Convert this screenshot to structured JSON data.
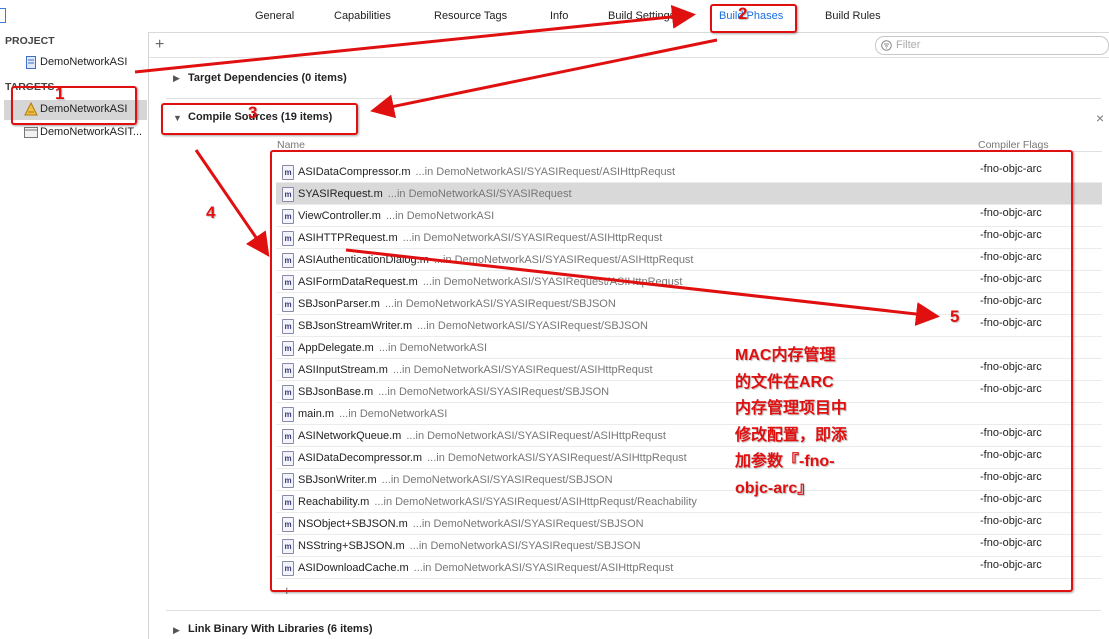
{
  "tabs": [
    "General",
    "Capabilities",
    "Resource Tags",
    "Info",
    "Build Settings",
    "Build Phases",
    "Build Rules"
  ],
  "sidebar": {
    "project_header": "PROJECT",
    "project_item": "DemoNetworkASI",
    "targets_header": "TARGETS",
    "targets": [
      "DemoNetworkASI",
      "DemoNetworkASIT..."
    ]
  },
  "toolbar": {
    "add": "+",
    "filter_placeholder": "Filter"
  },
  "sections": {
    "target_dependencies": "Target Dependencies (0 items)",
    "compile_sources": "Compile Sources (19 items)",
    "link_binary": "Link Binary With Libraries (6 items)",
    "close": "×"
  },
  "table": {
    "col_name": "Name",
    "col_flags": "Compiler Flags",
    "add": "+",
    "rows": [
      {
        "file": "ASIDataCompressor.m",
        "path": "...in DemoNetworkASI/SYASIRequest/ASIHttpRequst",
        "flags": "-fno-objc-arc"
      },
      {
        "file": "SYASIRequest.m",
        "path": "...in DemoNetworkASI/SYASIRequest",
        "flags": ""
      },
      {
        "file": "ViewController.m",
        "path": "...in DemoNetworkASI",
        "flags": "-fno-objc-arc"
      },
      {
        "file": "ASIHTTPRequest.m",
        "path": "...in DemoNetworkASI/SYASIRequest/ASIHttpRequst",
        "flags": "-fno-objc-arc"
      },
      {
        "file": "ASIAuthenticationDialog.m",
        "path": "...in DemoNetworkASI/SYASIRequest/ASIHttpRequst",
        "flags": "-fno-objc-arc"
      },
      {
        "file": "ASIFormDataRequest.m",
        "path": "...in DemoNetworkASI/SYASIRequest/ASIHttpRequst",
        "flags": "-fno-objc-arc"
      },
      {
        "file": "SBJsonParser.m",
        "path": "...in DemoNetworkASI/SYASIRequest/SBJSON",
        "flags": "-fno-objc-arc"
      },
      {
        "file": "SBJsonStreamWriter.m",
        "path": "...in DemoNetworkASI/SYASIRequest/SBJSON",
        "flags": "-fno-objc-arc"
      },
      {
        "file": "AppDelegate.m",
        "path": "...in DemoNetworkASI",
        "flags": ""
      },
      {
        "file": "ASIInputStream.m",
        "path": "...in DemoNetworkASI/SYASIRequest/ASIHttpRequst",
        "flags": "-fno-objc-arc"
      },
      {
        "file": "SBJsonBase.m",
        "path": "...in DemoNetworkASI/SYASIRequest/SBJSON",
        "flags": "-fno-objc-arc"
      },
      {
        "file": "main.m",
        "path": "...in DemoNetworkASI",
        "flags": ""
      },
      {
        "file": "ASINetworkQueue.m",
        "path": "...in DemoNetworkASI/SYASIRequest/ASIHttpRequst",
        "flags": "-fno-objc-arc"
      },
      {
        "file": "ASIDataDecompressor.m",
        "path": "...in DemoNetworkASI/SYASIRequest/ASIHttpRequst",
        "flags": "-fno-objc-arc"
      },
      {
        "file": "SBJsonWriter.m",
        "path": "...in DemoNetworkASI/SYASIRequest/SBJSON",
        "flags": "-fno-objc-arc"
      },
      {
        "file": "Reachability.m",
        "path": "...in DemoNetworkASI/SYASIRequest/ASIHttpRequst/Reachability",
        "flags": "-fno-objc-arc"
      },
      {
        "file": "NSObject+SBJSON.m",
        "path": "...in DemoNetworkASI/SYASIRequest/SBJSON",
        "flags": "-fno-objc-arc"
      },
      {
        "file": "NSString+SBJSON.m",
        "path": "...in DemoNetworkASI/SYASIRequest/SBJSON",
        "flags": "-fno-objc-arc"
      },
      {
        "file": "ASIDownloadCache.m",
        "path": "...in DemoNetworkASI/SYASIRequest/ASIHttpRequst",
        "flags": "-fno-objc-arc"
      }
    ]
  },
  "annotations": {
    "numbers": [
      "1",
      "2",
      "3",
      "4",
      "5"
    ],
    "note": [
      "MAC内存管理",
      "的文件在ARC",
      "内存管理项目中",
      "修改配置，即添",
      "加参数『-fno-",
      "objc-arc』"
    ],
    "color": "#e01010"
  }
}
